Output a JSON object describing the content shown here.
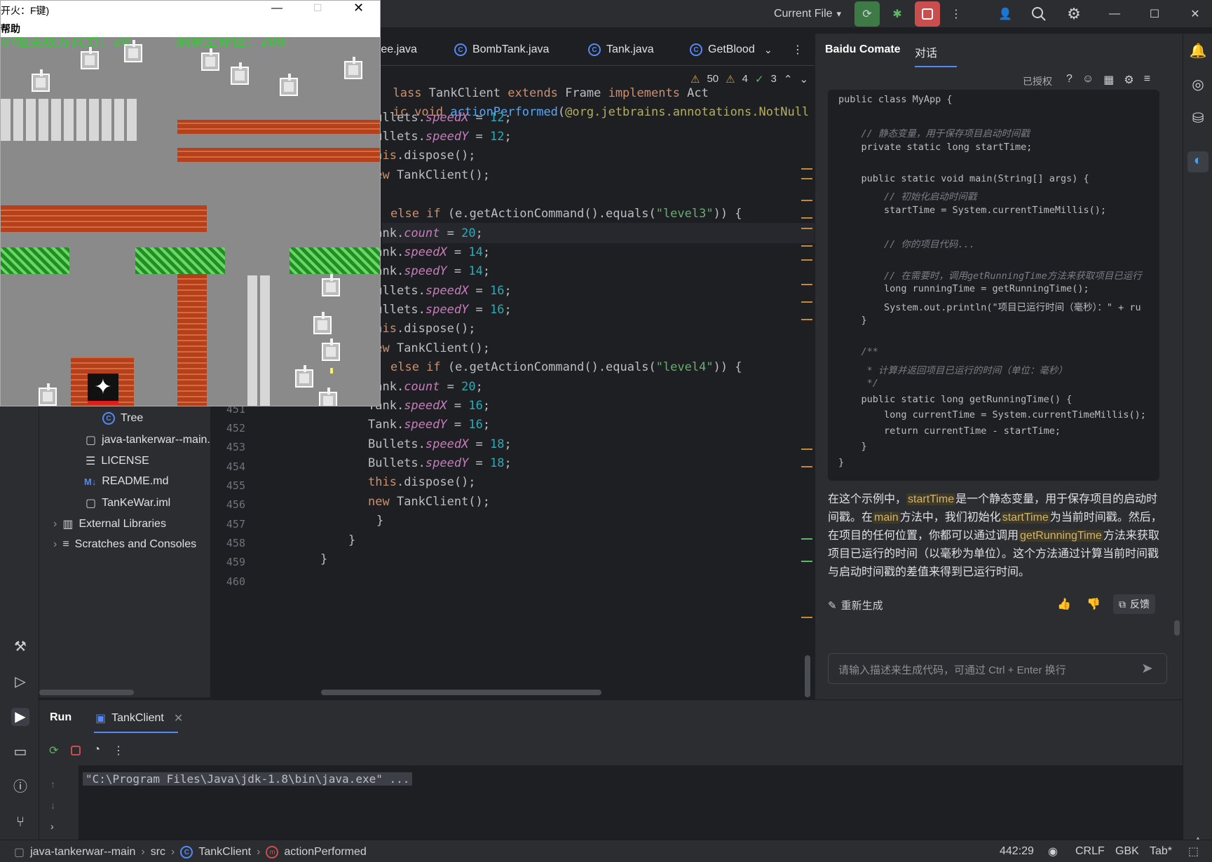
{
  "topbar": {
    "run_config": "Current File",
    "run_config_chevron": "▾",
    "more": "⋮"
  },
  "editor_tabs": [
    {
      "label": "ree.java"
    },
    {
      "label": "BombTank.java"
    },
    {
      "label": "Tank.java"
    },
    {
      "label": "GetBlood"
    }
  ],
  "inspections": {
    "warnings": "50",
    "weak_warnings": "4",
    "ok": "3"
  },
  "code": {
    "header1": "lass TankClient extends Frame implements Act",
    "header2": "ic void actionPerformed(@org.jetbrains.annotations.NotNull Act:",
    "line_numbers": [
      "451",
      "452",
      "453",
      "454",
      "455",
      "456",
      "457",
      "458",
      "459",
      "460"
    ],
    "lines": [
      "Bullets.speedX = 12;",
      "Bullets.speedY = 12;",
      "this.dispose();",
      "new TankClient();",
      "",
      "else if (e.getActionCommand().equals(\"level3\")) {",
      "Tank.count = 20;",
      "Tank.speedX = 14;",
      "Tank.speedY = 14;",
      "Bullets.speedX = 16;",
      "Bullets.speedY = 16;",
      "this.dispose();",
      "new TankClient();",
      "else if (e.getActionCommand().equals(\"level4\")) {",
      "Tank.count = 20;",
      "Tank.speedX = 16;",
      "Tank.speedY = 16;",
      "Bullets.speedX = 18;",
      "Bullets.speedY = 18;",
      "this.dispose();",
      "new TankClient();",
      "}",
      "}",
      "}"
    ]
  },
  "project_tree": [
    {
      "label": "Tree",
      "icon": "C"
    },
    {
      "label": "java-tankerwar--main.",
      "icon": "file"
    },
    {
      "label": "LICENSE",
      "icon": "lines"
    },
    {
      "label": "README.md",
      "icon": "M↓"
    },
    {
      "label": "TanKeWar.iml",
      "icon": "file"
    },
    {
      "label": "External Libraries",
      "icon": "lib"
    },
    {
      "label": "Scratches and Consoles",
      "icon": "scratch"
    }
  ],
  "right_panel": {
    "title": "Baidu Comate",
    "tab": "对话",
    "authorized": "已授权",
    "code_lines": [
      "public class MyApp {",
      "",
      "    // 静态变量，用于保存项目启动时间戳",
      "    private static long startTime;",
      "",
      "    public static void main(String[] args) {",
      "        // 初始化启动时间戳",
      "        startTime = System.currentTimeMillis();",
      "",
      "        // 你的项目代码...",
      "",
      "        // 在需要时，调用getRunningTime方法来获取项目已运行",
      "        long runningTime = getRunningTime();",
      "        System.out.println(\"项目已运行时间（毫秒）：\" + ru",
      "    }",
      "",
      "    /**",
      "     * 计算并返回项目已运行的时间（单位：毫秒）",
      "     */",
      "    public static long getRunningTime() {",
      "        long currentTime = System.currentTimeMillis();",
      "        return currentTime - startTime;",
      "    }",
      "}"
    ],
    "explain_parts": [
      {
        "t": "在这个示例中，",
        "hl": false
      },
      {
        "t": "startTime",
        "hl": true
      },
      {
        "t": "是一个静态变量，用于保存项目的启动时间戳。在",
        "hl": false
      },
      {
        "t": "main",
        "hl": true
      },
      {
        "t": "方法中，我们初始化",
        "hl": false
      },
      {
        "t": "startTime",
        "hl": true
      },
      {
        "t": "为当前时间戳。然后，在项目的任何位置，你都可以通过调用",
        "hl": false
      },
      {
        "t": "getRunningTime",
        "hl": true
      },
      {
        "t": "方法来获取项目已运行的时间（以毫秒为单位）。这个方法通过计算当前时间戳与启动时间戳的差值来得到已运行时间。",
        "hl": false
      }
    ],
    "regenerate": "重新生成",
    "feedback": "反馈",
    "input_placeholder": "请输入描述来生成代码，可通过 Ctrl + Enter 换行"
  },
  "run_panel": {
    "tab_run": "Run",
    "tab_config": "TankClient",
    "console_line": "\"C:\\Program Files\\Java\\jdk-1.8\\bin\\java.exe\" ..."
  },
  "statusbar": {
    "crumbs": [
      "java-tankerwar--main",
      "src",
      "TankClient",
      "actionPerformed"
    ],
    "position": "442:29",
    "line_ending": "CRLF",
    "encoding": "GBK",
    "indent": "Tab*"
  },
  "game": {
    "title": "开火：F键)",
    "menu": "帮助",
    "hud_left": "小坦克敌方兵力：20",
    "hud_right": "剩余生命值：200"
  },
  "colors": {
    "accent_blue": "#548af7",
    "run_green": "#3d7a46",
    "stop_red": "#c94f4f",
    "highlight": "#d6b36b"
  }
}
